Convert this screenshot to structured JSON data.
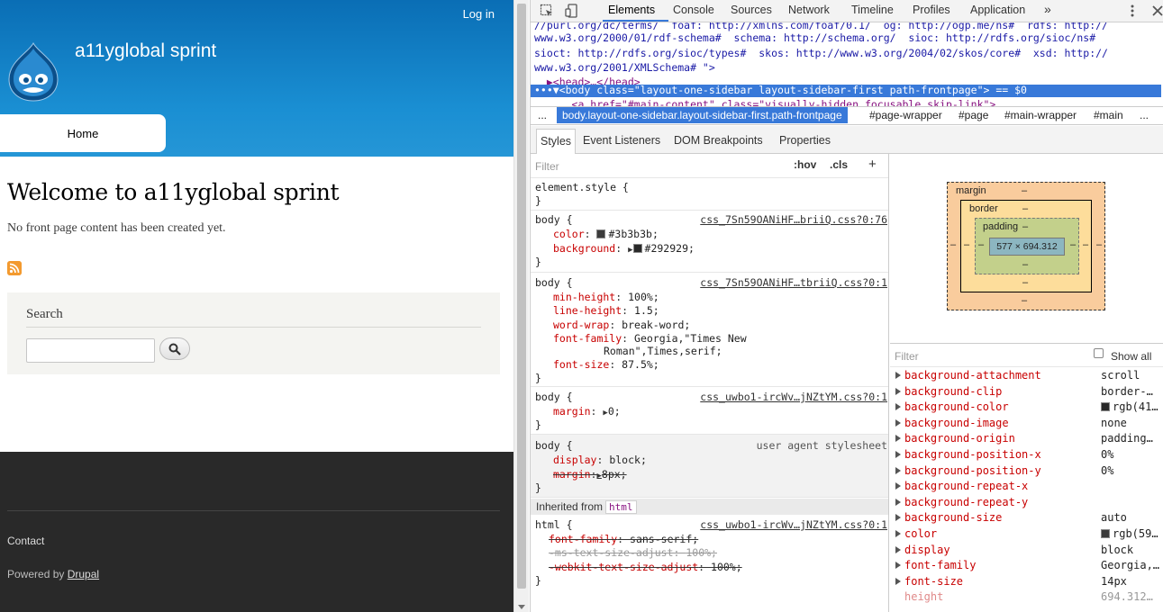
{
  "site": {
    "login": "Log in",
    "name": "a11yglobal sprint",
    "nav_home": "Home",
    "page_title": "Welcome to a11yglobal sprint",
    "no_content": "No front page content has been created yet.",
    "search_title": "Search",
    "footer_contact": "Contact",
    "footer_powered_prefix": "Powered by",
    "footer_powered_link": "Drupal"
  },
  "devtools": {
    "tabs": [
      "Elements",
      "Console",
      "Sources",
      "Network",
      "Timeline",
      "Profiles",
      "Application"
    ],
    "more": "»",
    "dom_lines": [
      "//purl.org/dc/terms/  foaf: http://xmlns.com/foaf/0.1/  og: http://ogp.me/ns#  rdfs: http://",
      "www.w3.org/2000/01/rdf-schema#  schema: http://schema.org/  sioc: http://rdfs.org/sioc/ns#",
      "sioct: http://rdfs.org/sioc/types#  skos: http://www.w3.org/2004/02/skos/core#  xsd: http://",
      "www.w3.org/2001/XMLSchema# \">",
      "  ▶<head>…</head>",
      "•••▼<body class=\"layout-one-sidebar layout-sidebar-first path-frontpage\"> == $0",
      "      <a href=\"#main-content\" class=\"visually-hidden focusable skip-link\">"
    ],
    "breadcrumbs": [
      "...",
      "body.layout-one-sidebar.layout-sidebar-first.path-frontpage",
      "#page-wrapper",
      "#page",
      "#main-wrapper",
      "#main",
      "..."
    ],
    "subtabs": [
      "Styles",
      "Event Listeners",
      "DOM Breakpoints",
      "Properties"
    ],
    "filter_placeholder": "Filter",
    "hov": ":hov",
    "cls": ".cls",
    "plus": "+",
    "rules": {
      "element_style_1": "element.style {",
      "element_style_2": "}",
      "body1_sel": "body {",
      "body1_src": "css_7Sn59OANiHF…briiQ.css?0:76",
      "body1_p1": "color",
      "body1_v1": "#3b3b3b;",
      "body1_p2": "background",
      "body1_v2": "#292929;",
      "body1_color_swatch": "#3b3b3b",
      "body1_bg_swatch": "#292929",
      "body2_sel": "body {",
      "body2_src": "css_7Sn59OANiHF…tbriiQ.css?0:1",
      "body2_p1": "min-height",
      "body2_v1": "100%;",
      "body2_p2": "line-height",
      "body2_v2": "1.5;",
      "body2_p3": "word-wrap",
      "body2_v3": "break-word;",
      "body2_p4": "font-family",
      "body2_v4": "Georgia,\"Times New",
      "body2_v4b": "Roman\",Times,serif;",
      "body2_p5": "font-size",
      "body2_v5": "87.5%;",
      "body3_sel": "body {",
      "body3_src": "css_uwbo1-ircWv…jNZtYM.css?0:1",
      "body3_p1": "margin",
      "body3_v1": "0;",
      "ua_sel": "body {",
      "ua_src": "user agent stylesheet",
      "ua_p1": "display",
      "ua_v1": "block;",
      "ua_p2": "margin",
      "ua_v2": "8px;",
      "close": "}",
      "inherited_label": "Inherited from",
      "inherited_tag": "html",
      "html_sel": "html {",
      "html_src": "css_uwbo1-ircWv…jNZtYM.css?0:1",
      "html_p1": "font-family",
      "html_v1": "sans-serif;",
      "html_p2": "-ms-text-size-adjust",
      "html_v2": "100%;",
      "html_p3": "-webkit-text-size-adjust",
      "html_v3": "100%;"
    },
    "box": {
      "margin": "margin",
      "border": "border",
      "padding": "padding",
      "content": "577 × 694.312",
      "dash": "–"
    },
    "computed_filter": "Filter",
    "show_all": "Show all",
    "computed": [
      {
        "name": "background-attachment",
        "value": "scroll"
      },
      {
        "name": "background-clip",
        "value": "border-…"
      },
      {
        "name": "background-color",
        "value": "rgb(41…",
        "swatch": "#292929"
      },
      {
        "name": "background-image",
        "value": "none"
      },
      {
        "name": "background-origin",
        "value": "padding…"
      },
      {
        "name": "background-position-x",
        "value": "0%"
      },
      {
        "name": "background-position-y",
        "value": "0%"
      },
      {
        "name": "background-repeat-x",
        "value": ""
      },
      {
        "name": "background-repeat-y",
        "value": ""
      },
      {
        "name": "background-size",
        "value": "auto"
      },
      {
        "name": "color",
        "value": "rgb(59…",
        "swatch": "#3b3b3b"
      },
      {
        "name": "display",
        "value": "block"
      },
      {
        "name": "font-family",
        "value": "Georgia,…"
      },
      {
        "name": "font-size",
        "value": "14px"
      },
      {
        "name": "height",
        "value": "694.312…",
        "inherited": true
      }
    ]
  }
}
